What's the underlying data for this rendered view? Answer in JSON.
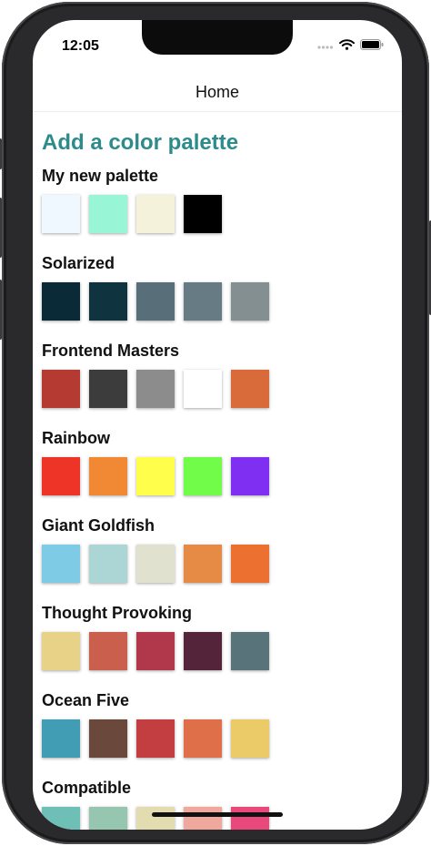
{
  "status_bar": {
    "time": "12:05"
  },
  "nav": {
    "title": "Home"
  },
  "add_palette_label": "Add a color palette",
  "palettes": [
    {
      "name": "My new palette",
      "colors": [
        "#f0f8ff",
        "#98f5d5",
        "#f5f2dc",
        "#000000"
      ]
    },
    {
      "name": "Solarized",
      "colors": [
        "#0b2a37",
        "#10343f",
        "#586f79",
        "#667b83",
        "#848f91"
      ]
    },
    {
      "name": "Frontend Masters",
      "colors": [
        "#b53a31",
        "#3c3c3c",
        "#8c8c8c",
        "#ffffff",
        "#d96a3a"
      ]
    },
    {
      "name": "Rainbow",
      "colors": [
        "#ee3427",
        "#f18934",
        "#fefe4b",
        "#71fc49",
        "#7f2ff2"
      ]
    },
    {
      "name": "Giant Goldfish",
      "colors": [
        "#7ecbe5",
        "#acd6d6",
        "#e0e2cf",
        "#e68b46",
        "#ec7131"
      ]
    },
    {
      "name": "Thought Provoking",
      "colors": [
        "#e8d288",
        "#cb5f4d",
        "#b1374a",
        "#54253a",
        "#58747a"
      ]
    },
    {
      "name": "Ocean Five",
      "colors": [
        "#409db3",
        "#6a493c",
        "#c23e41",
        "#de6f49",
        "#eacb67"
      ]
    },
    {
      "name": "Compatible",
      "colors": [
        "#6ebfb5",
        "#96c6b0",
        "#e2dcb0",
        "#f0a79e",
        "#e8497a"
      ]
    }
  ]
}
